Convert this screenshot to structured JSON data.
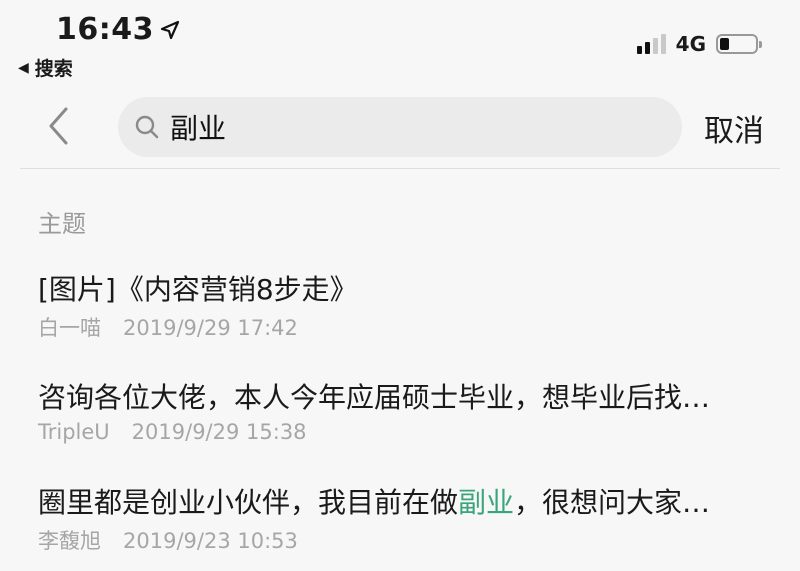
{
  "status_bar": {
    "time": "16:43",
    "back_app": "搜索",
    "network": "4G",
    "signal_bars_on": 2,
    "signal_bars_total": 4,
    "battery_level": 0.25
  },
  "search": {
    "query": "副业",
    "cancel_label": "取消"
  },
  "section": {
    "title": "主题"
  },
  "results": [
    {
      "title": "[图片]《内容营销8步走》",
      "author": "白一喵",
      "date": "2019/9/29 17:42"
    },
    {
      "title": "咨询各位大佬，本人今年应届硕士毕业，想毕业后找…",
      "author": "TripleU",
      "date": "2019/9/29 15:38"
    },
    {
      "title_before": "圈里都是创业小伙伴，我目前在做",
      "title_highlight": "副业",
      "title_after": "，很想问大家…",
      "author": "李馥旭",
      "date": "2019/9/23 10:53"
    }
  ],
  "colors": {
    "highlight": "#3aa57a",
    "meta_text": "#a6a6a6",
    "search_bg": "#ebebeb"
  }
}
